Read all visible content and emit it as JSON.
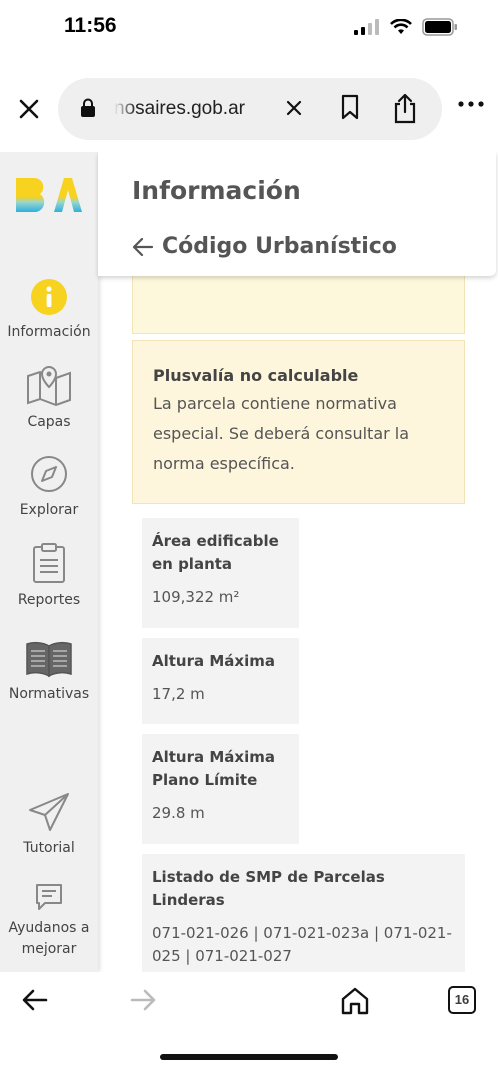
{
  "status": {
    "time": "11:56"
  },
  "browser": {
    "url": "nosaires.gob.ar"
  },
  "sidebar": {
    "items": [
      {
        "label": "Información",
        "icon": "info-icon"
      },
      {
        "label": "Capas",
        "icon": "map-icon"
      },
      {
        "label": "Explorar",
        "icon": "compass-icon"
      },
      {
        "label": "Reportes",
        "icon": "clipboard-icon"
      },
      {
        "label": "Normativas",
        "icon": "book-icon"
      },
      {
        "label": "Tutorial",
        "icon": "paper-plane-icon"
      },
      {
        "label": "Ayudanos a mejorar",
        "icon": "chat-icon"
      }
    ]
  },
  "panel": {
    "title": "Información",
    "subtitle": "Código Urbanístico"
  },
  "notice": {
    "title": "Plusvalía no calculable",
    "text": "La parcela contiene normativa especial. Se deberá consultar la norma específica."
  },
  "cards": [
    {
      "title": "Área edificable en planta",
      "value": "109,322 m²"
    },
    {
      "title": "Altura Máxima",
      "value": "17,2 m"
    },
    {
      "title": "Altura Máxima Plano Límite",
      "value": "29.8 m"
    },
    {
      "title": "Listado de SMP de Parcelas Linderas",
      "value": "071-021-026 | 071-021-023a | 071-021-025 | 071-021-027"
    }
  ],
  "bottom": {
    "tab_count": "16"
  },
  "colors": {
    "accent_yellow": "#f7d21e",
    "notice_bg": "#fdf6dc"
  }
}
